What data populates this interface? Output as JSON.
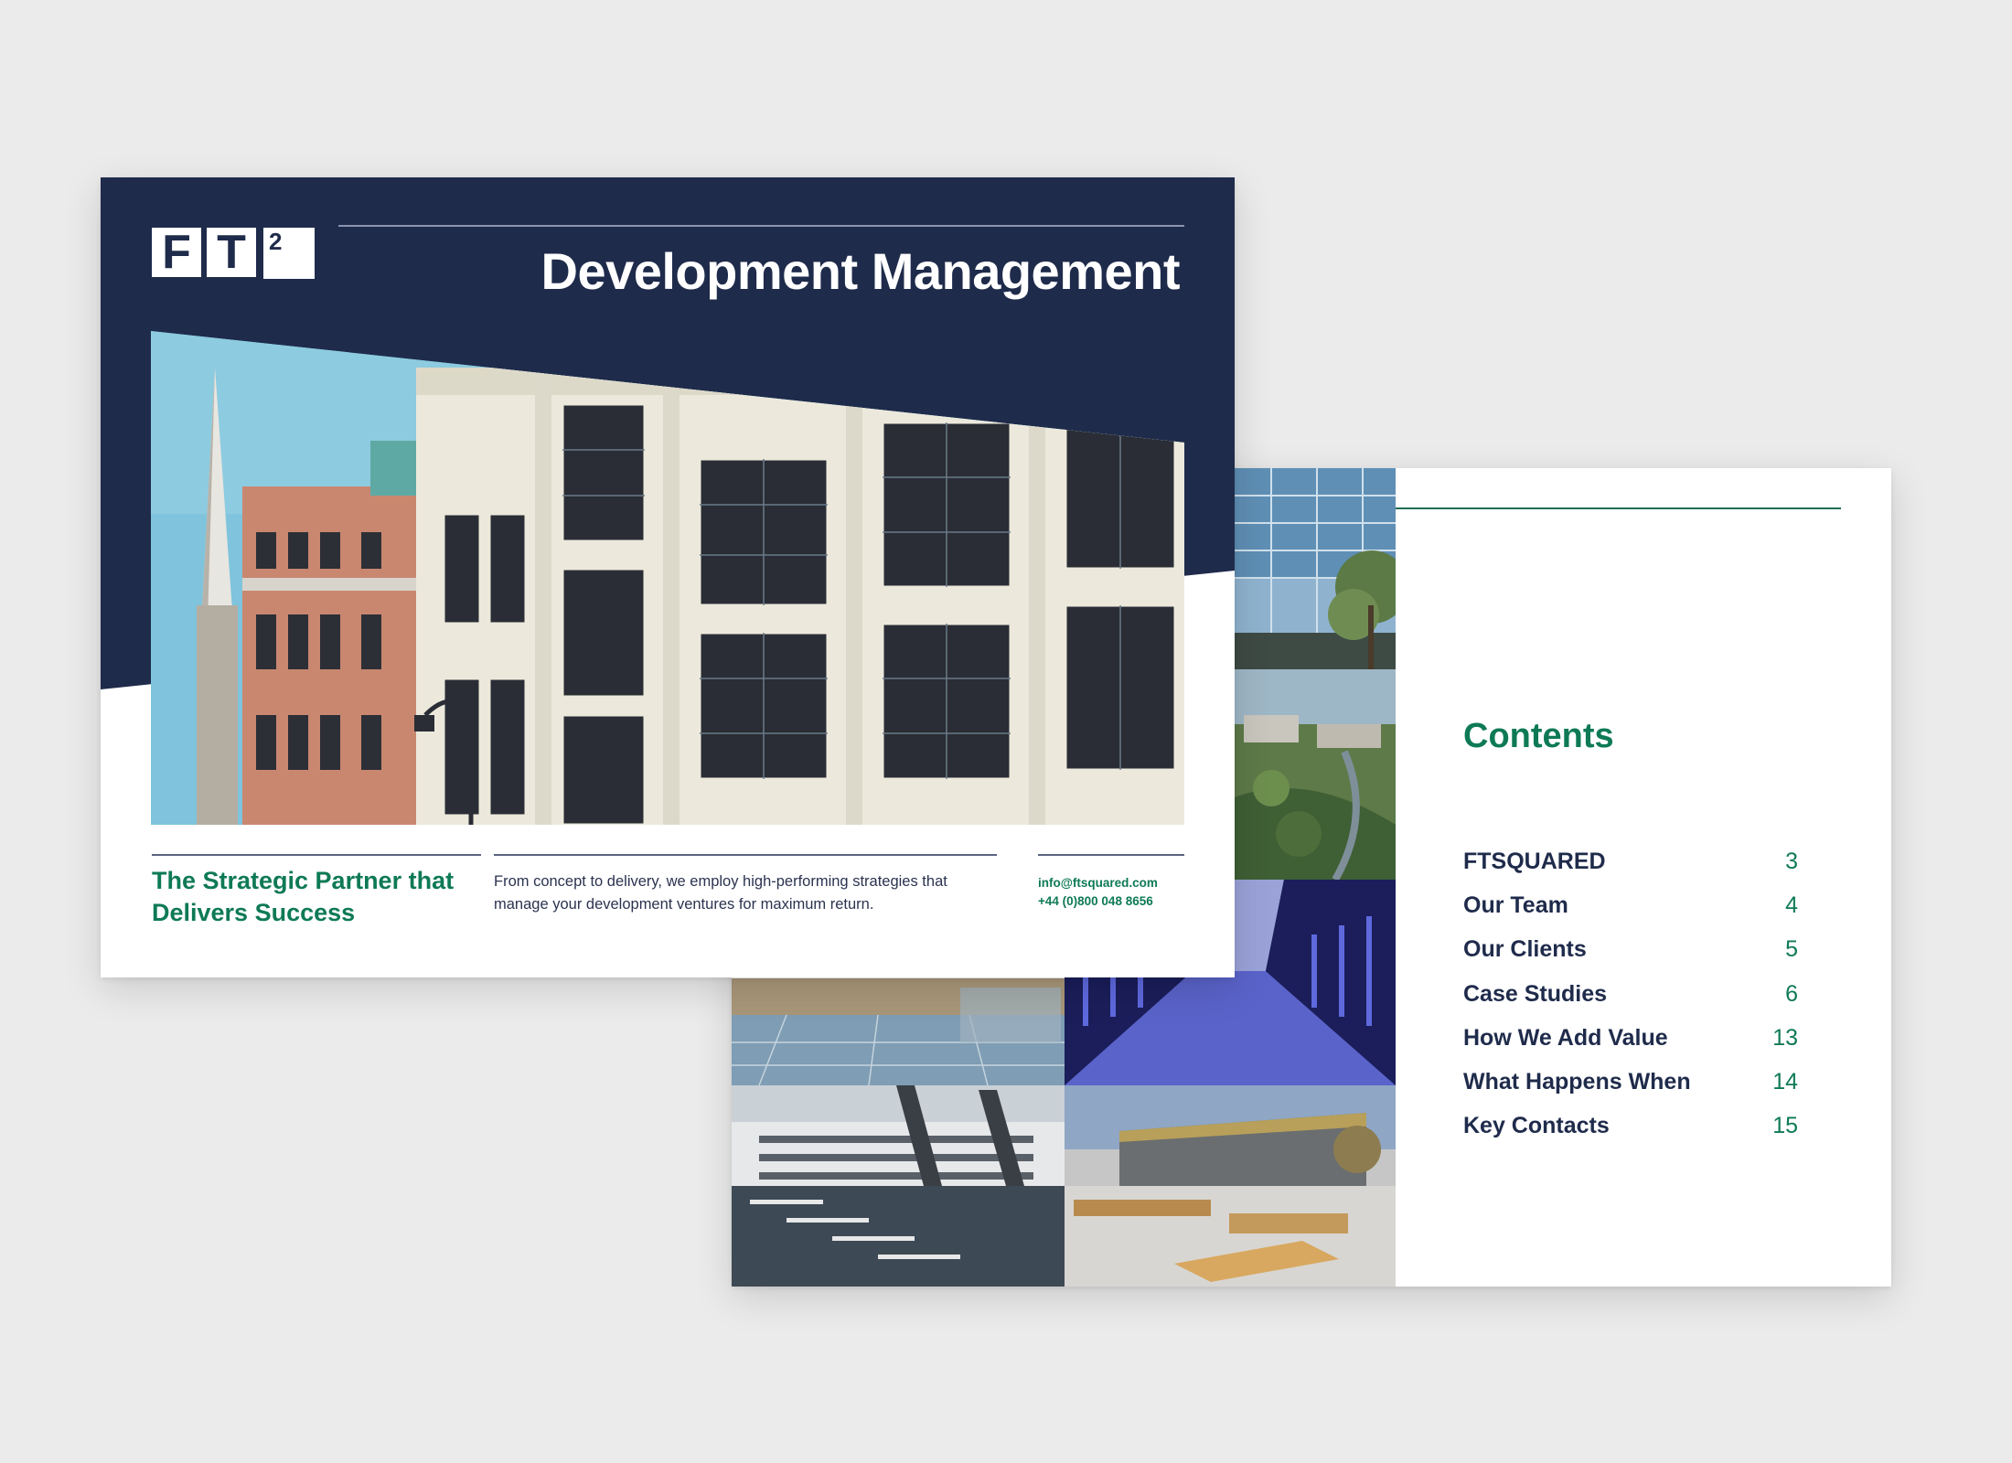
{
  "cover": {
    "logo_letters": [
      "F",
      "T"
    ],
    "logo_superscript": "2",
    "title": "Development Management",
    "tagline": "The Strategic Partner that Delivers Success",
    "blurb": "From concept to delivery, we employ high-performing strategies that manage your development ventures for maximum return.",
    "email": "info@ftsquared.com",
    "phone": "+44 (0)800 048 8656"
  },
  "contents": {
    "title": "Contents",
    "items": [
      {
        "label": "FTSQUARED",
        "page": "3"
      },
      {
        "label": "Our Team",
        "page": "4"
      },
      {
        "label": "Our Clients",
        "page": "5"
      },
      {
        "label": "Case Studies",
        "page": "6"
      },
      {
        "label": "How We Add Value",
        "page": "13"
      },
      {
        "label": "What Happens When",
        "page": "14"
      },
      {
        "label": "Key Contacts",
        "page": "15"
      }
    ]
  },
  "colors": {
    "navy": "#1f2b4b",
    "green": "#0e7a55",
    "page_background": "#ebebeb"
  }
}
